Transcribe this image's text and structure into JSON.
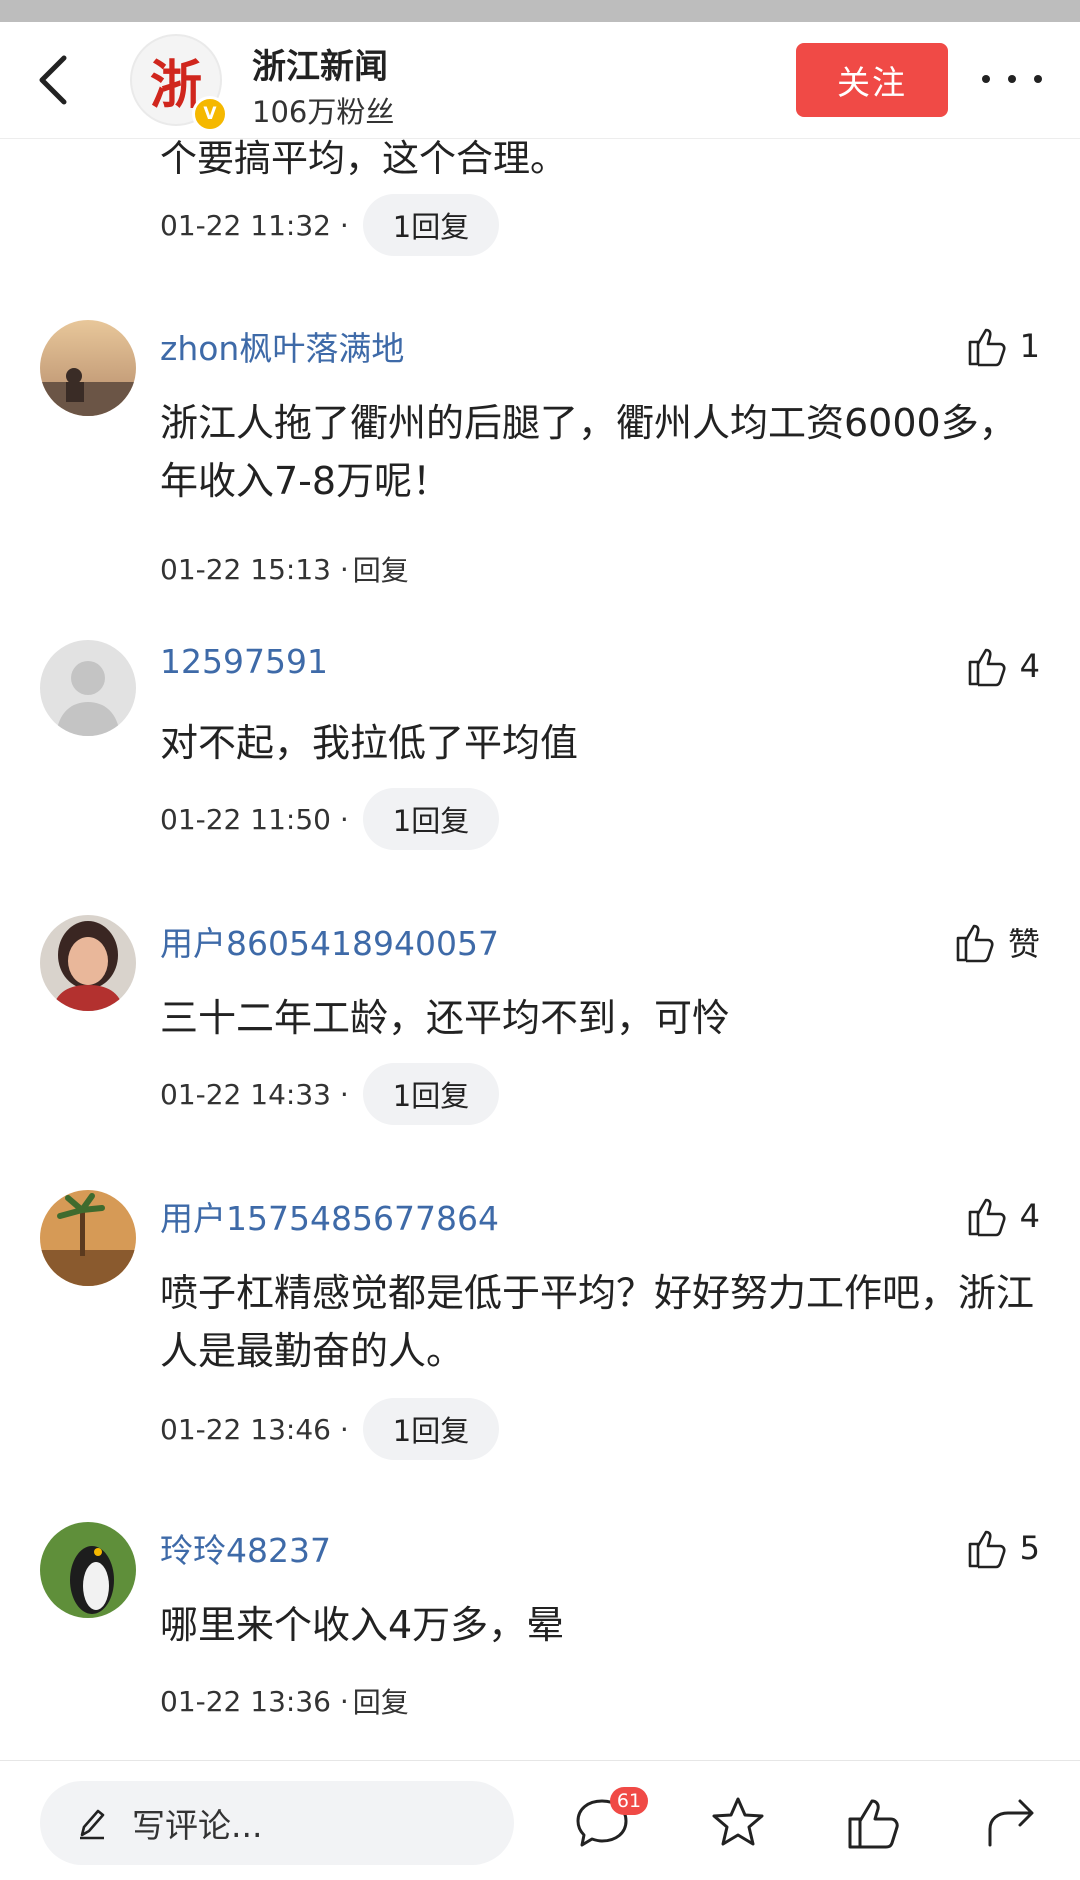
{
  "header": {
    "back_label": "<",
    "account_name": "浙江新闻",
    "account_fans": "106万粉丝",
    "avatar_text": "浙",
    "verified_mark": "V",
    "follow_label": "关注"
  },
  "partial_comment": {
    "text": "个要搞平均，这个合理。",
    "time": "01-22 11:32 ·",
    "reply": "1回复"
  },
  "comments": [
    {
      "name": "zhon枫叶落满地",
      "likes": "1",
      "text": "浙江人拖了衢州的后腿了，衢州人均工资6000多，年收入7-8万呢！",
      "time": "01-22 15:13 ·",
      "reply": "回复"
    },
    {
      "name": "12597591",
      "likes": "4",
      "text": "对不起，我拉低了平均值",
      "time": "01-22 11:50 ·",
      "reply": "1回复"
    },
    {
      "name": "用户8605418940057",
      "likes": "赞",
      "text": "三十二年工龄，还平均不到，可怜",
      "time": "01-22 14:33 ·",
      "reply": "1回复"
    },
    {
      "name": "用户1575485677864",
      "likes": "4",
      "text": "喷子杠精感觉都是低于平均？好好努力工作吧，浙江人是最勤奋的人。",
      "time": "01-22 13:46 ·",
      "reply": "1回复"
    },
    {
      "name": "玲玲48237",
      "likes": "5",
      "text": "哪里来个收入4万多，晕",
      "time": "01-22 13:36 ·",
      "reply": "回复"
    }
  ],
  "bottom_bar": {
    "write_placeholder": "写评论...",
    "comment_count": "61",
    "icons": [
      "pencil-icon",
      "comment-icon",
      "star-icon",
      "thumbs-up-icon",
      "share-icon"
    ]
  },
  "colors": {
    "accent": "#f04a46",
    "username": "#3e6aa8",
    "pill_bg": "#f1f2f4",
    "verified": "#f5b800"
  }
}
